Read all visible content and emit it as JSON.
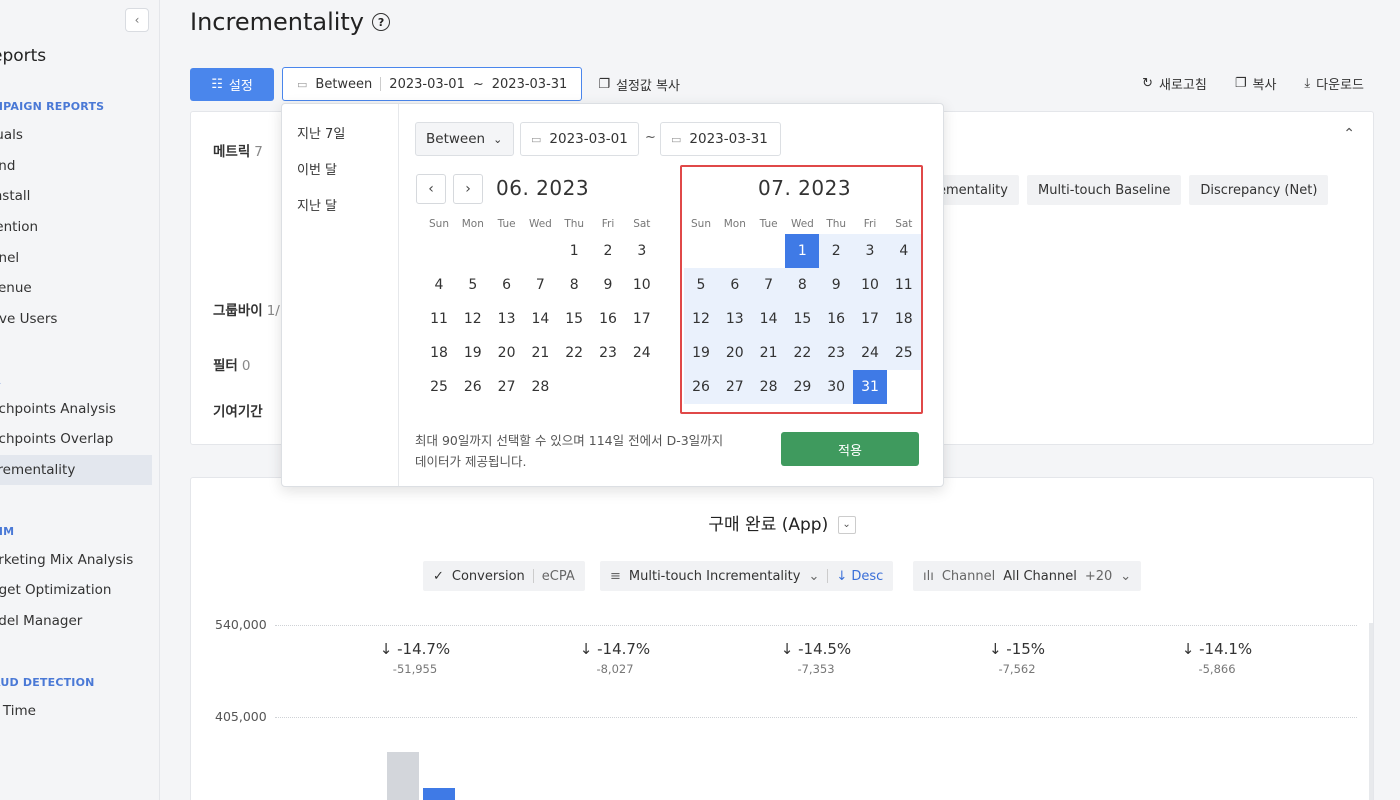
{
  "sidebar": {
    "collapse_icon": "‹",
    "title": "eports",
    "sections": [
      {
        "label": "MPAIGN REPORTS",
        "top": 100
      },
      {
        "label": "A",
        "top": 374
      },
      {
        "label": "MM",
        "top": 525
      },
      {
        "label": "AUD DETECTION",
        "top": 676
      }
    ],
    "items": [
      "tuals",
      "end",
      "install",
      "tention",
      "nnel",
      "venue",
      "tive Users",
      "uchpoints Analysis",
      "uchpoints Overlap",
      "crementality",
      "arketing Mix Analysis",
      "dget Optimization",
      "odel Manager",
      "g Time"
    ]
  },
  "header": {
    "title": "Incrementality",
    "help_icon": "?"
  },
  "toolbar": {
    "settings_label": "설정",
    "range_mode": "Between",
    "start_date": "2023-03-01",
    "tilde": "~",
    "end_date": "2023-03-31",
    "copy_settings_label": "설정값 복사",
    "refresh_label": "새로고침",
    "copy_label": "복사",
    "download_label": "다운로드"
  },
  "settings_card": {
    "metric_label": "메트릭",
    "metric_count": "7",
    "groupby_label": "그룹바이",
    "groupby_count": "1/",
    "filter_label": "필터",
    "filter_count": "0",
    "attribution_label": "기여기간",
    "metric_chips": [
      "ementality",
      "Multi-touch Baseline",
      "Discrepancy (Net)"
    ]
  },
  "datepicker": {
    "presets": [
      "지난 7일",
      "이번 달",
      "지난 달"
    ],
    "mode": "Between",
    "start_date": "2023-03-01",
    "tilde": "~",
    "end_date": "2023-03-31",
    "left_month": "06. 2023",
    "right_month": "07. 2023",
    "weekdays": [
      "Sun",
      "Mon",
      "Tue",
      "Wed",
      "Thu",
      "Fri",
      "Sat"
    ],
    "left_first_weekday": 4,
    "left_days": 28,
    "right_first_weekday": 3,
    "right_days": 31,
    "selected_start": 1,
    "selected_end": 31,
    "note_line1": "최대 90일까지 선택할 수 있으며 114일 전에서 D-3일까지",
    "note_line2": "데이터가 제공됩니다.",
    "apply_label": "적용"
  },
  "chart_card": {
    "title": "구매 완료 (App)",
    "metric_check": "✓",
    "metric_active": "Conversion",
    "metric_inactive": "eCPA",
    "sort_field": "Multi-touch Incrementality",
    "sort_dir": "Desc",
    "channel_label": "Channel",
    "channel_value": "All Channel",
    "channel_more": "+20",
    "y_ticks": [
      "540,000",
      "405,000"
    ],
    "stats": [
      {
        "pct": "-14.7%",
        "abs": "-51,955"
      },
      {
        "pct": "-14.7%",
        "abs": "-8,027"
      },
      {
        "pct": "-14.5%",
        "abs": "-7,353"
      },
      {
        "pct": "-15%",
        "abs": "-7,562"
      },
      {
        "pct": "-14.1%",
        "abs": "-5,866"
      }
    ]
  },
  "chart_data": {
    "type": "bar",
    "ylim": [
      0,
      540000
    ],
    "yticks": [
      "540,000",
      "405,000"
    ],
    "series": [
      {
        "name": "",
        "color": "#d3d6db"
      },
      {
        "name": "",
        "color": "#3f7ae6"
      }
    ],
    "deltas": [
      {
        "pct": "-14.7%",
        "abs": "-51,955"
      },
      {
        "pct": "-14.7%",
        "abs": "-8,027"
      },
      {
        "pct": "-14.5%",
        "abs": "-7,353"
      },
      {
        "pct": "-15%",
        "abs": "-7,562"
      },
      {
        "pct": "-14.1%",
        "abs": "-5,866"
      }
    ]
  },
  "colors": {
    "primary": "#4a86ec",
    "selected": "#3f7ae6",
    "range": "#eaf1fc",
    "apply": "#3f9a5e",
    "highlight_box": "#e04848"
  }
}
